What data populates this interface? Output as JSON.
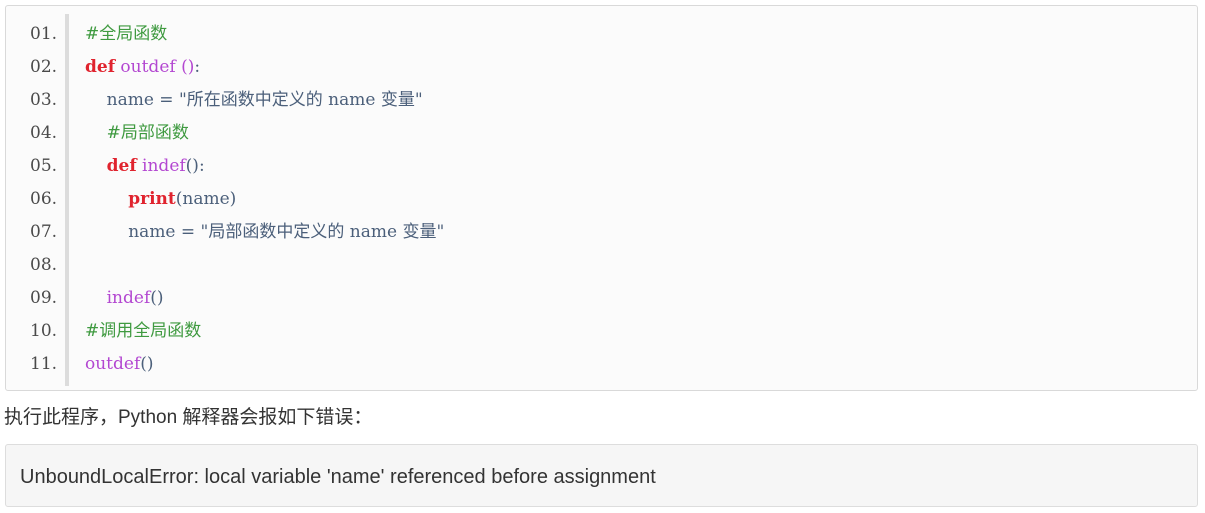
{
  "code": {
    "lines": [
      {
        "num": "01.",
        "tokens": [
          {
            "t": "#全局函数",
            "c": "c-comment"
          }
        ]
      },
      {
        "num": "02.",
        "tokens": [
          {
            "t": "def",
            "c": "c-kw"
          },
          {
            "t": " ",
            "c": "c-plain"
          },
          {
            "t": "outdef",
            "c": "c-fn"
          },
          {
            "t": " ",
            "c": "c-plain"
          },
          {
            "t": "()",
            "c": "c-fn"
          },
          {
            "t": ":",
            "c": "c-plain"
          }
        ]
      },
      {
        "num": "03.",
        "tokens": [
          {
            "t": "    name = ",
            "c": "c-plain"
          },
          {
            "t": "\"所在函数中定义的 name 变量\"",
            "c": "c-str"
          }
        ]
      },
      {
        "num": "04.",
        "tokens": [
          {
            "t": "    ",
            "c": "c-plain"
          },
          {
            "t": "#局部函数",
            "c": "c-comment"
          }
        ]
      },
      {
        "num": "05.",
        "tokens": [
          {
            "t": "    ",
            "c": "c-plain"
          },
          {
            "t": "def",
            "c": "c-kw"
          },
          {
            "t": " ",
            "c": "c-plain"
          },
          {
            "t": "indef",
            "c": "c-fn"
          },
          {
            "t": "()",
            "c": "c-plain"
          },
          {
            "t": ":",
            "c": "c-plain"
          }
        ]
      },
      {
        "num": "06.",
        "tokens": [
          {
            "t": "        ",
            "c": "c-plain"
          },
          {
            "t": "print",
            "c": "c-kw"
          },
          {
            "t": "(name)",
            "c": "c-plain"
          }
        ]
      },
      {
        "num": "07.",
        "tokens": [
          {
            "t": "        name = ",
            "c": "c-plain"
          },
          {
            "t": "\"局部函数中定义的 name 变量\"",
            "c": "c-str"
          }
        ]
      },
      {
        "num": "08.",
        "tokens": []
      },
      {
        "num": "09.",
        "tokens": [
          {
            "t": "    ",
            "c": "c-plain"
          },
          {
            "t": "indef",
            "c": "c-fn"
          },
          {
            "t": "()",
            "c": "c-plain"
          }
        ]
      },
      {
        "num": "10.",
        "tokens": [
          {
            "t": "#调用全局函数",
            "c": "c-comment"
          }
        ]
      },
      {
        "num": "11.",
        "tokens": [
          {
            "t": "outdef",
            "c": "c-fn"
          },
          {
            "t": "()",
            "c": "c-plain"
          }
        ]
      }
    ]
  },
  "explanation": "执行此程序，Python 解释器会报如下错误：",
  "error_message": "UnboundLocalError: local variable 'name' referenced before assignment",
  "colors": {
    "comment": "#3f9a40",
    "keyword": "#e0232e",
    "function": "#b347d1",
    "plain": "#4b5f7a"
  }
}
